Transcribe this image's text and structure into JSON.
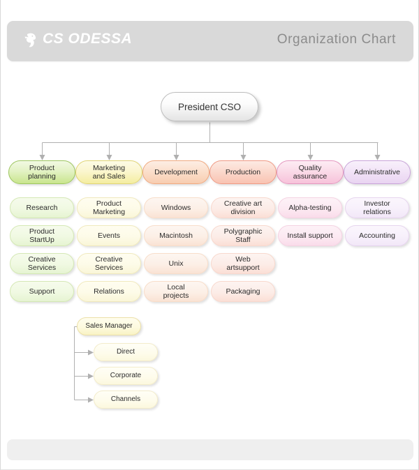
{
  "header": {
    "logo_text": "CS ODESSA",
    "logo_icon": "bird-logo-icon",
    "title": "Organization Chart"
  },
  "footer": {
    "text": ""
  },
  "chart": {
    "type": "org-chart",
    "root": {
      "label": "President CSO"
    },
    "departments": [
      {
        "label": "Product\nplanning",
        "color": "#c9e58d",
        "children": [
          {
            "label": "Research"
          },
          {
            "label": "Product\nStartUp"
          },
          {
            "label": "Creative\nServices"
          },
          {
            "label": "Support"
          }
        ]
      },
      {
        "label": "Marketing\nand Sales",
        "color": "#f4eda0",
        "children": [
          {
            "label": "Product\nMarketing"
          },
          {
            "label": "Events"
          },
          {
            "label": "Creative\nServices"
          },
          {
            "label": "Relations"
          }
        ]
      },
      {
        "label": "Development",
        "color": "#f8cdb0",
        "children": [
          {
            "label": "Windows"
          },
          {
            "label": "Macintosh"
          },
          {
            "label": "Unix"
          },
          {
            "label": "Local\nprojects"
          }
        ]
      },
      {
        "label": "Production",
        "color": "#f9c3b2",
        "children": [
          {
            "label": "Creative art\ndivision"
          },
          {
            "label": "Polygraphic\nStaff"
          },
          {
            "label": "Web\nartsupport"
          },
          {
            "label": "Packaging"
          }
        ]
      },
      {
        "label": "Quality\nassurance",
        "color": "#f7c2da",
        "children": [
          {
            "label": "Alpha-testing"
          },
          {
            "label": "Install support"
          }
        ]
      },
      {
        "label": "Administrative",
        "color": "#e9d4f1",
        "children": [
          {
            "label": "Investor\nrelations"
          },
          {
            "label": "Accounting"
          }
        ]
      }
    ],
    "sales_branch": {
      "head": {
        "label": "Sales Manager"
      },
      "items": [
        {
          "label": "Direct"
        },
        {
          "label": "Corporate"
        },
        {
          "label": "Channels"
        }
      ]
    }
  }
}
